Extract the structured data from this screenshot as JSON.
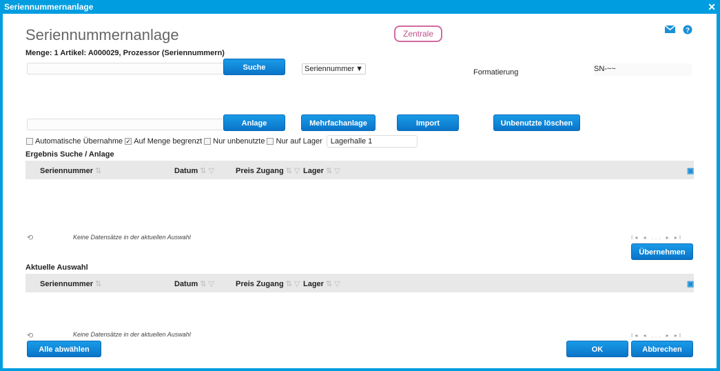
{
  "window": {
    "title": "Seriennummernanlage",
    "close": "✕"
  },
  "header": {
    "title": "Seriennummernanlage",
    "zentrale": "Zentrale",
    "subtitle": "Menge: 1 Artikel: A000029, Prozessor (Seriennummern)"
  },
  "search": {
    "value": "",
    "button": "Suche",
    "select": "Seriennummer",
    "formatting_label": "Formatierung",
    "formatting_value": "SN-~~"
  },
  "create": {
    "value": "",
    "buttons": {
      "anlage": "Anlage",
      "mehrfach": "Mehrfachanlage",
      "import": "Import",
      "unused": "Unbenutzte löschen"
    }
  },
  "options": [
    {
      "label": "Automatische Übernahme",
      "checked": false
    },
    {
      "label": "Auf Menge begrenzt",
      "checked": true
    },
    {
      "label": "Nur unbenutzte",
      "checked": false
    },
    {
      "label": "Nur auf Lager",
      "checked": false
    }
  ],
  "lager_value": "Lagerhalle 1",
  "result": {
    "title": "Ergebnis Suche / Anlage",
    "columns": [
      "Seriennummer",
      "Datum",
      "Preis Zugang",
      "Lager"
    ],
    "empty": "Keine Datensätze in der aktuellen Auswahl",
    "pager": "I◂ ◂ ... ▸ ▸I",
    "apply": "Übernehmen"
  },
  "selection": {
    "title": "Aktuelle Auswahl",
    "columns": [
      "Seriennummer",
      "Datum",
      "Preis Zugang",
      "Lager"
    ],
    "empty": "Keine Datensätze in der aktuellen Auswahl",
    "pager": "I◂ ◂ ... ▸ ▸I"
  },
  "footer": {
    "deselect": "Alle abwählen",
    "ok": "OK",
    "cancel": "Abbrechen"
  }
}
